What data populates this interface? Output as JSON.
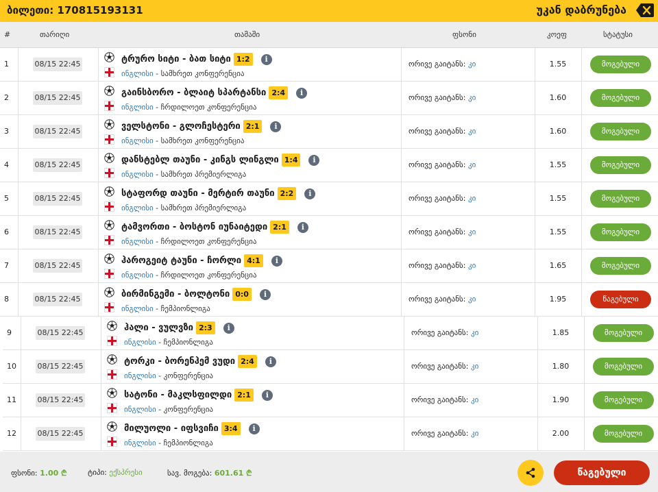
{
  "header": {
    "ticket_label": "ბილეთი: 170815193131",
    "back_label": "უკან დაბრუნება",
    "close_icon": "close-x-icon"
  },
  "columns": {
    "num": "#",
    "date": "თარიღი",
    "game": "თამაში",
    "bet": "ფსონი",
    "coef": "კოეფ",
    "status": "სტატუსი"
  },
  "rows": [
    {
      "num": "1",
      "date": "08/15 22:45",
      "match": "ტრურო სიტი - ბათ სიტი",
      "score": "1:2",
      "country": "ინგლისი",
      "league": "სამხრეთ კონფერენცია",
      "bet_label": "ორივე გაიტანს:",
      "bet_value": "კი",
      "coef": "1.55",
      "status": "მოგებული",
      "status_type": "win"
    },
    {
      "num": "2",
      "date": "08/15 22:45",
      "match": "გაინსბორო - ბლაიტ სპარტანსი",
      "score": "2:4",
      "country": "ინგლისი",
      "league": "ჩრდილოეთ კონფერენცია",
      "bet_label": "ორივე გაიტანს:",
      "bet_value": "კი",
      "coef": "1.60",
      "status": "მოგებული",
      "status_type": "win"
    },
    {
      "num": "3",
      "date": "08/15 22:45",
      "match": "ველსტონი - გლოჩესტერი",
      "score": "2:1",
      "country": "ინგლისი",
      "league": "სამხრეთ კონფერენცია",
      "bet_label": "ორივე გაიტანს:",
      "bet_value": "კი",
      "coef": "1.60",
      "status": "მოგებული",
      "status_type": "win"
    },
    {
      "num": "4",
      "date": "08/15 22:45",
      "match": "დანსტებლ თაუნი - კინგს ლინგლი",
      "score": "1:4",
      "country": "ინგლისი",
      "league": "სამხრეთ პრემიერლიგა",
      "bet_label": "ორივე გაიტანს:",
      "bet_value": "კი",
      "coef": "1.55",
      "status": "მოგებული",
      "status_type": "win"
    },
    {
      "num": "5",
      "date": "08/15 22:45",
      "match": "სტაფორდ თაუნი - მერტირ თაუნი",
      "score": "2:2",
      "country": "ინგლისი",
      "league": "სამხრეთ პრემიერლიგა",
      "bet_label": "ორივე გაიტანს:",
      "bet_value": "კი",
      "coef": "1.55",
      "status": "მოგებული",
      "status_type": "win"
    },
    {
      "num": "6",
      "date": "08/15 22:45",
      "match": "ტამვორთი - ბოსტონ იუნაიტედი",
      "score": "2:1",
      "country": "ინგლისი",
      "league": "ჩრდილოეთ კონფერენცია",
      "bet_label": "ორივე გაიტანს:",
      "bet_value": "კი",
      "coef": "1.55",
      "status": "მოგებული",
      "status_type": "win"
    },
    {
      "num": "7",
      "date": "08/15 22:45",
      "match": "ჰაროგეიტ ტაუნი - ჩორლი",
      "score": "4:1",
      "country": "ინგლისი",
      "league": "ჩრდილოეთ კონფერენცია",
      "bet_label": "ორივე გაიტანს:",
      "bet_value": "კი",
      "coef": "1.65",
      "status": "მოგებული",
      "status_type": "win"
    },
    {
      "num": "8",
      "date": "08/15 22:45",
      "match": "ბირმინგემი - ბოლტონი",
      "score": "0:0",
      "country": "ინგლისი",
      "league": "ჩემპიონლიგა",
      "bet_label": "ორივე გაიტანს:",
      "bet_value": "კი",
      "coef": "1.95",
      "status": "წაგებული",
      "status_type": "lose"
    },
    {
      "num": "9",
      "date": "08/15 22:45",
      "match": "ჰალი - ვულვზი",
      "score": "2:3",
      "country": "ინგლისი",
      "league": "ჩემპიონლიგა",
      "bet_label": "ორივე გაიტანს:",
      "bet_value": "კი",
      "coef": "1.85",
      "status": "მოგებული",
      "status_type": "win"
    },
    {
      "num": "10",
      "date": "08/15 22:45",
      "match": "ტორკი - ბორენჰემ ვუდი",
      "score": "2:4",
      "country": "ინგლისი",
      "league": "კონფერენცია",
      "bet_label": "ორივე გაიტანს:",
      "bet_value": "კი",
      "coef": "1.80",
      "status": "მოგებული",
      "status_type": "win"
    },
    {
      "num": "11",
      "date": "08/15 22:45",
      "match": "სატონი - მაკლსფილდი",
      "score": "2:1",
      "country": "ინგლისი",
      "league": "კონფერენცია",
      "bet_label": "ორივე გაიტანს:",
      "bet_value": "კი",
      "coef": "1.90",
      "status": "მოგებული",
      "status_type": "win"
    },
    {
      "num": "12",
      "date": "08/15 22:45",
      "match": "მილუოლი - იფსვიჩი",
      "score": "3:4",
      "country": "ინგლისი",
      "league": "ჩემპიონლიგა",
      "bet_label": "ორივე გაიტანს:",
      "bet_value": "კი",
      "coef": "2.00",
      "status": "მოგებული",
      "status_type": "win"
    }
  ],
  "footer": {
    "stake_label": "ფსონი:",
    "stake_value": "1.00 ₾",
    "type_label": "ტიპი:",
    "type_value": "ექსპრესი",
    "win_label": "სავ. მოგება:",
    "win_value": "601.61 ₾",
    "share_icon": "share-icon",
    "result_label": "წაგებული"
  },
  "colors": {
    "accent": "#ffc81f",
    "win": "#6aab3a",
    "lose": "#cc2e13",
    "link": "#2b78b7"
  }
}
